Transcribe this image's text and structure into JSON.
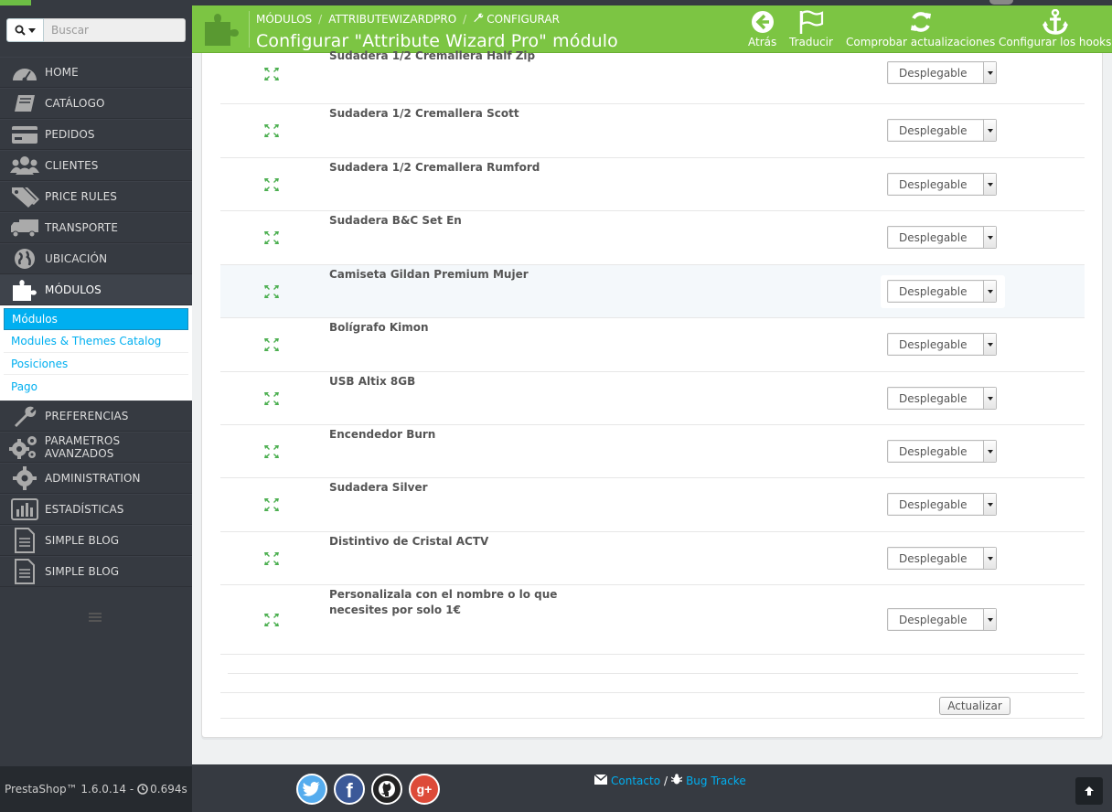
{
  "search": {
    "placeholder": "Buscar"
  },
  "sidebar": {
    "items_top": [
      {
        "label": "HOME",
        "icon": "dashboard-icon"
      },
      {
        "label": "CATÁLOGO",
        "icon": "book-icon"
      },
      {
        "label": "PEDIDOS",
        "icon": "credit-card-icon"
      },
      {
        "label": "CLIENTES",
        "icon": "users-icon"
      },
      {
        "label": "PRICE RULES",
        "icon": "tags-icon"
      },
      {
        "label": "TRANSPORTE",
        "icon": "truck-icon"
      },
      {
        "label": "UBICACIÓN",
        "icon": "globe-icon"
      },
      {
        "label": "MÓDULOS",
        "icon": "puzzle-icon"
      }
    ],
    "submenu": [
      {
        "label": "Módulos",
        "active": true
      },
      {
        "label": "Modules & Themes Catalog",
        "active": false
      },
      {
        "label": "Posiciones",
        "active": false
      },
      {
        "label": "Pago",
        "active": false
      }
    ],
    "items_bottom": [
      {
        "label": "PREFERENCIAS",
        "icon": "wrench-icon"
      },
      {
        "label": "PARAMETROS AVANZADOS",
        "icon": "cogs-icon"
      },
      {
        "label": "ADMINISTRATION",
        "icon": "cog-icon"
      },
      {
        "label": "ESTADÍSTICAS",
        "icon": "bar-chart-icon"
      },
      {
        "label": "SIMPLE BLOG",
        "icon": "file-text-icon"
      },
      {
        "label": "SIMPLE BLOG",
        "icon": "file-text-icon"
      }
    ]
  },
  "header": {
    "breadcrumb": [
      "MÓDULOS",
      "ATTRIBUTEWIZARDPRO",
      "CONFIGURAR"
    ],
    "title": "Configurar \"Attribute Wizard Pro\" módulo",
    "toolbar": [
      {
        "label": "Atrás",
        "icon": "arrow-circle-left-icon"
      },
      {
        "label": "Traducir",
        "icon": "flag-icon"
      },
      {
        "label": "Comprobar actualizaciones",
        "icon": "refresh-icon"
      },
      {
        "label": "Configurar los hooks",
        "icon": "anchor-icon"
      }
    ]
  },
  "rows": [
    {
      "name": "Sudadera 1/2 Cremallera Half Zip",
      "select": "Desplegable"
    },
    {
      "name": "Sudadera 1/2 Cremallera Scott",
      "select": "Desplegable"
    },
    {
      "name": "Sudadera 1/2 Cremallera Rumford",
      "select": "Desplegable"
    },
    {
      "name": "Sudadera B&C Set En",
      "select": "Desplegable"
    },
    {
      "name": "Camiseta Gildan Premium Mujer",
      "select": "Desplegable",
      "highlight": true
    },
    {
      "name": "Bolígrafo Kimon",
      "select": "Desplegable"
    },
    {
      "name": "USB Altix 8GB",
      "select": "Desplegable"
    },
    {
      "name": "Encendedor Burn",
      "select": "Desplegable"
    },
    {
      "name": "Sudadera Silver",
      "select": "Desplegable"
    },
    {
      "name": "Distintivo de Cristal ACTV",
      "select": "Desplegable"
    },
    {
      "name": "Personalizala con el nombre o lo que necesites por solo 1€",
      "select": "Desplegable"
    }
  ],
  "update_button": "Actualizar",
  "footer": {
    "version": "PrestaShop™ 1.6.0.14 -",
    "load_time": "0.694s",
    "contact": "Contacto",
    "contact_sep": "/",
    "bug_tracker": "Bug Tracke"
  },
  "colors": {
    "header_green": "#7cc543",
    "link_blue": "#00aff0",
    "sidebar_dark": "#363a41"
  }
}
